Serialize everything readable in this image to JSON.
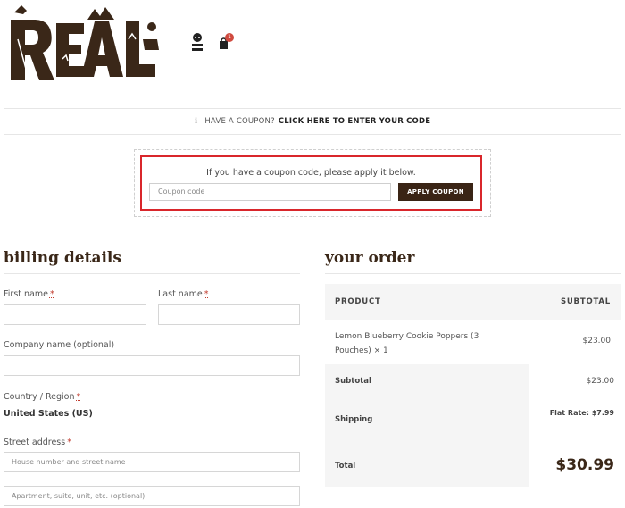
{
  "header": {
    "brand": "REAL",
    "cart_count": "1",
    "brand_color": "#3a2718"
  },
  "coupon_notice": {
    "prefix": "HAVE A COUPON?",
    "link": "CLICK HERE TO ENTER YOUR CODE",
    "icon": "info-icon"
  },
  "coupon_form": {
    "description": "If you have a coupon code, please apply it below.",
    "placeholder": "Coupon code",
    "button": "APPLY COUPON",
    "highlight_color": "#d9262b"
  },
  "billing": {
    "heading": "billing details",
    "first_name_label": "First name",
    "last_name_label": "Last name",
    "company_label": "Company name (optional)",
    "country_label": "Country / Region",
    "country_value": "United States (US)",
    "street_label": "Street address",
    "street_placeholder": "House number and street name",
    "street2_placeholder": "Apartment, suite, unit, etc. (optional)",
    "required_mark": "*"
  },
  "order": {
    "heading": "your order",
    "col_product": "PRODUCT",
    "col_subtotal": "SUBTOTAL",
    "item_name": "Lemon Blueberry Cookie Poppers (3 Pouches)",
    "item_qty": "× 1",
    "item_price": "$23.00",
    "subtotal_label": "Subtotal",
    "subtotal_value": "$23.00",
    "shipping_label": "Shipping",
    "shipping_value": "Flat Rate: $7.99",
    "total_label": "Total",
    "total_value": "$30.99"
  }
}
